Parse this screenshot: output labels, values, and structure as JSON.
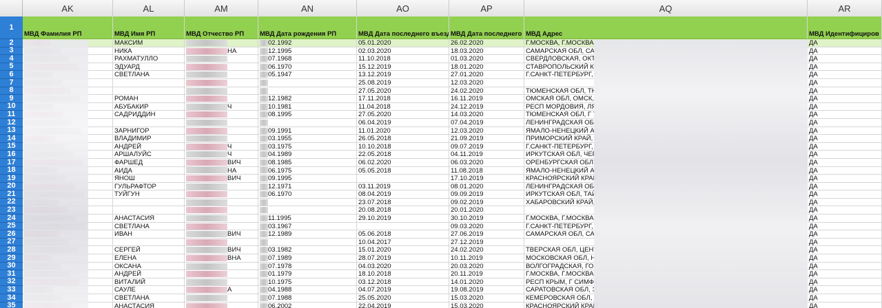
{
  "columns": [
    "AK",
    "AL",
    "AM",
    "AN",
    "AO",
    "AP",
    "AQ",
    "AR"
  ],
  "header_row_number": "1",
  "headers": [
    "МВД Фамилия РП",
    "МВД Имя РП",
    "МВД Отчество РП",
    "МВД Дата рождения РП",
    "МВД Дата последнего въезда",
    "МВД Дата последнего в",
    "МВД Адрес",
    "МВД Идентифициров"
  ],
  "rows": [
    {
      "n": "2",
      "name": "МАКСИМ",
      "mid": "",
      "dob": "02.1992",
      "entry": "05.01.2020",
      "last": "26.02.2020",
      "addr": "Г.МОСКВА, Г.МОСКВА, ",
      "id": "ДА"
    },
    {
      "n": "3",
      "name": "НИКА",
      "mid": "НА",
      "dob": "12.1995",
      "entry": "02.03.2020",
      "last": "18.03.2020",
      "addr": "САМАРСКАЯ ОБЛ, САМ",
      "id": "ДА"
    },
    {
      "n": "4",
      "name": "РАХМАТУЛЛО",
      "mid": "",
      "dob": "07.1968",
      "entry": "11.10.2018",
      "last": "01.03.2020",
      "addr": "СВЕРДЛОВСКАЯ, ОКТЯ",
      "id": "ДА"
    },
    {
      "n": "5",
      "name": "ЭДУАРД",
      "mid": "",
      "dob": "06.1970",
      "entry": "15.12.2019",
      "last": "18.01.2020",
      "addr": "СТАВРОПОЛЬСКИЙ КР",
      "id": "ДА"
    },
    {
      "n": "6",
      "name": "СВЕТЛАНА",
      "mid": "",
      "dob": "05.1947",
      "entry": "13.12.2019",
      "last": "27.01.2020",
      "addr": "Г.САНКТ-ПЕТЕРБУРГ, Г",
      "id": "ДА"
    },
    {
      "n": "7",
      "name": "",
      "mid": "",
      "dob": "",
      "entry": "25.08.2019",
      "last": "12.03.2020",
      "addr": "",
      "id": "ДА"
    },
    {
      "n": "8",
      "name": "",
      "mid": "",
      "dob": "",
      "entry": "27.05.2020",
      "last": "24.02.2020",
      "addr": "ТЮМЕНСКАЯ ОБЛ, ТЮ",
      "id": "ДА"
    },
    {
      "n": "9",
      "name": "РОМАН",
      "mid": "",
      "dob": "12.1982",
      "entry": "17.11.2018",
      "last": "16.11.2019",
      "addr": "ОМСКАЯ ОБЛ, ОМСК, ",
      "id": "ДА"
    },
    {
      "n": "10",
      "name": "АБУБАКИР",
      "mid": "Ч",
      "dob": "10.1981",
      "entry": "11.04.2018",
      "last": "24.12.2019",
      "addr": "РЕСП МОРДОВИЯ, ЛЯ",
      "id": "ДА"
    },
    {
      "n": "11",
      "name": "САДРИДДИН",
      "mid": "",
      "dob": "08.1995",
      "entry": "27.05.2020",
      "last": "14.03.2020",
      "addr": "ТЮМЕНСКАЯ ОБЛ, Г Т",
      "id": "ДА"
    },
    {
      "n": "12",
      "name": "",
      "mid": "",
      "dob": "",
      "entry": "06.04.2019",
      "last": "07.04.2019",
      "addr": "ЛЕНИНГРАДСКАЯ ОБЛ",
      "id": "ДА"
    },
    {
      "n": "13",
      "name": "ЗАРНИГОР",
      "mid": "",
      "dob": "09.1991",
      "entry": "11.01.2020",
      "last": "12.03.2020",
      "addr": "ЯМАЛО-НЕНЕЦКИЙ АС",
      "id": "ДА"
    },
    {
      "n": "14",
      "name": "ВЛАДИМИР",
      "mid": "",
      "dob": "03.1955",
      "entry": "26.05.2018",
      "last": "21.09.2019",
      "addr": "ПРИМОРСКИЙ КРАЙ, П",
      "id": "ДА"
    },
    {
      "n": "15",
      "name": "АНДРЕЙ",
      "mid": "Ч",
      "dob": "03.1975",
      "entry": "10.10.2018",
      "last": "09.07.2019",
      "addr": "Г.САНКТ-ПЕТЕРБУРГ, Г",
      "id": "ДА"
    },
    {
      "n": "16",
      "name": "АРШАЛУЙС",
      "mid": "Ч",
      "dob": "04.1989",
      "entry": "22.05.2018",
      "last": "04.11.2019",
      "addr": "ИРКУТСКАЯ ОБЛ, ЧЕР",
      "id": "ДА"
    },
    {
      "n": "17",
      "name": "ФАРШЕД",
      "mid": "ВИЧ",
      "dob": "08.1985",
      "entry": "06.02.2020",
      "last": "06.03.2020",
      "addr": "ОРЕНБУРГСКАЯ ОБЛ, ",
      "id": "ДА"
    },
    {
      "n": "18",
      "name": "АИДА",
      "mid": "НА",
      "dob": "06.1975",
      "entry": "05.05.2018",
      "last": "11.08.2018",
      "addr": "ЯМАЛО-НЕНЕЦКИЙ АС",
      "id": "ДА"
    },
    {
      "n": "19",
      "name": "ЯНОШ",
      "mid": "ВИЧ",
      "dob": "09.1995",
      "entry": "",
      "last": "17.10.2019",
      "addr": "КРАСНОЯРСКИЙ КРАЙ",
      "id": "ДА"
    },
    {
      "n": "20",
      "name": "ГУЛЬРАФТОР",
      "mid": "",
      "dob": "12.1971",
      "entry": "03.11.2019",
      "last": "08.01.2020",
      "addr": "ЛЕНИНГРАДСКАЯ ОБЛ",
      "id": "ДА"
    },
    {
      "n": "21",
      "name": "ТУЙГУН",
      "mid": "",
      "dob": "06.1970",
      "entry": "08.04.2019",
      "last": "09.09.2019",
      "addr": "ИРКУТСКАЯ ОБЛ, ТАЙ",
      "id": "ДА"
    },
    {
      "n": "22",
      "name": "",
      "mid": "",
      "dob": "",
      "entry": "23.07.2018",
      "last": "09.02.2019",
      "addr": "ХАБАРОВСКИЙ КРАЙ, ",
      "id": "ДА"
    },
    {
      "n": "23",
      "name": "",
      "mid": "",
      "dob": "",
      "entry": "20.08.2018",
      "last": "20.01.2020",
      "addr": "",
      "id": "ДА"
    },
    {
      "n": "24",
      "name": "АНАСТАСИЯ",
      "mid": "",
      "dob": "11.1995",
      "entry": "29.10.2019",
      "last": "30.10.2019",
      "addr": "Г.МОСКВА, Г.МОСКВА, ",
      "id": "ДА"
    },
    {
      "n": "25",
      "name": "СВЕТЛАНА",
      "mid": "",
      "dob": "03.1967",
      "entry": "",
      "last": "09.03.2020",
      "addr": "Г.САНКТ-ПЕТЕРБУРГ, Г",
      "id": "ДА"
    },
    {
      "n": "26",
      "name": "ИВАН",
      "mid": "ВИЧ",
      "dob": "12.1989",
      "entry": "05.06.2018",
      "last": "27.06.2019",
      "addr": "САМАРСКАЯ ОБЛ, САМ",
      "id": "ДА"
    },
    {
      "n": "27",
      "name": "",
      "mid": "",
      "dob": "",
      "entry": "10.04.2017",
      "last": "27.12.2019",
      "addr": "",
      "id": "ДА"
    },
    {
      "n": "28",
      "name": "СЕРГЕЙ",
      "mid": "ВИЧ",
      "dob": "03.1982",
      "entry": "15.01.2020",
      "last": "24.02.2020",
      "addr": "ТВЕРСКАЯ ОБЛ, ЦЕНТ",
      "id": "ДА"
    },
    {
      "n": "29",
      "name": "ЕЛЕНА",
      "mid": "ВНА",
      "dob": "07.1989",
      "entry": "28.07.2019",
      "last": "10.11.2019",
      "addr": "МОСКОВСКАЯ ОБЛ, Н",
      "id": "ДА"
    },
    {
      "n": "30",
      "name": "ОКСАНА",
      "mid": "",
      "dob": "07.1978",
      "entry": "04.03.2020",
      "last": "20.03.2020",
      "addr": "ВОЛГОГРАДСКАЯ, ГО",
      "id": "ДА"
    },
    {
      "n": "31",
      "name": "АНДРЕЙ",
      "mid": "",
      "dob": "01.1979",
      "entry": "18.10.2018",
      "last": "20.11.2019",
      "addr": "Г.МОСКВА, Г.МОСКВА, ",
      "id": "ДА"
    },
    {
      "n": "32",
      "name": "ВИТАЛИЙ",
      "mid": "",
      "dob": "10.1975",
      "entry": "03.12.2018",
      "last": "14.01.2020",
      "addr": "РЕСП КРЫМ, Г СИМФЕ",
      "id": "ДА"
    },
    {
      "n": "33",
      "name": "САУЛЕ",
      "mid": "А",
      "dob": "04.1988",
      "entry": "04.07.2019",
      "last": "19.08.2019",
      "addr": "САРАТОВСКАЯ ОБЛ, Э",
      "id": "ДА"
    },
    {
      "n": "34",
      "name": "СВЕТЛАНА",
      "mid": "",
      "dob": "07.1988",
      "entry": "25.05.2020",
      "last": "15.03.2020",
      "addr": "КЕМЕРОВСКАЯ ОБЛ, Г",
      "id": "ДА"
    },
    {
      "n": "35",
      "name": "АНАСТАСИЯ",
      "mid": "",
      "dob": "06.2002",
      "entry": "22.04.2019",
      "last": "15.03.2020",
      "addr": "КРАСНОЯРСКИЙ КРАЙ",
      "id": "ДА"
    }
  ]
}
